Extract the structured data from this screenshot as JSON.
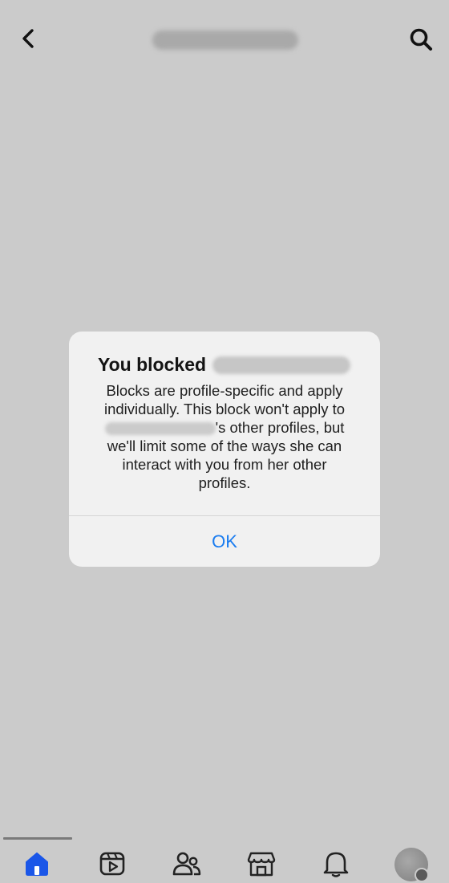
{
  "header": {
    "back_icon": "chevron-left-icon",
    "search_icon": "search-icon"
  },
  "dialog": {
    "title_prefix": "You blocked",
    "body_line_1": "Blocks are profile-specific and apply",
    "body_line_2": "individually. This block won't apply to",
    "body_line_3_suffix": "'s other profiles, but",
    "body_line_4": "we'll limit some of the ways she can",
    "body_line_5": "interact with you from her other",
    "body_line_6": "profiles.",
    "ok_label": "OK"
  },
  "bottom_nav": {
    "items": [
      {
        "icon": "home-icon",
        "active": true
      },
      {
        "icon": "video-icon",
        "active": false
      },
      {
        "icon": "friends-icon",
        "active": false
      },
      {
        "icon": "marketplace-icon",
        "active": false
      },
      {
        "icon": "bell-icon",
        "active": false
      },
      {
        "icon": "avatar",
        "active": false
      }
    ]
  },
  "colors": {
    "background": "#cbcbcb",
    "dialog_background": "#f1f1f1",
    "accent": "#1a7cf0",
    "active_nav": "#1a56e8"
  }
}
